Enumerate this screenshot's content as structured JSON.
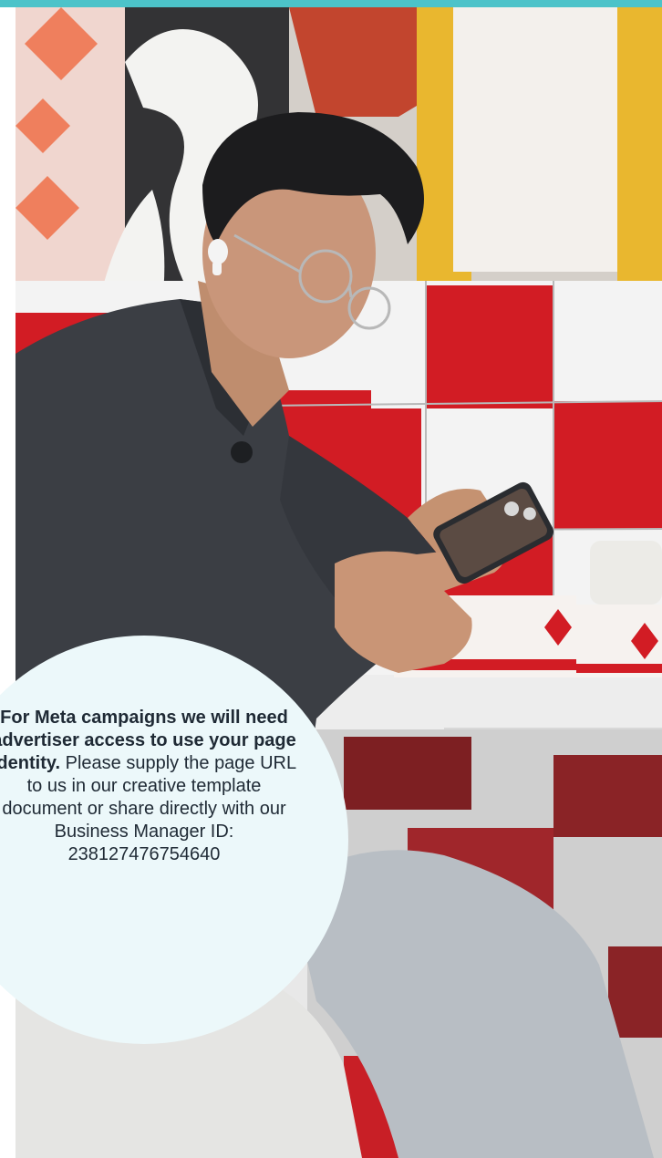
{
  "colors": {
    "accent_bar": "#4cc3c9",
    "bubble_background": "#ecf8fa",
    "text": "#1f2a35"
  },
  "photo": {
    "icon": "person-using-phone-photo"
  },
  "info": {
    "bold_text": "For Meta campaigns we will need advertiser access to use your page identity.",
    "body_text": "Please supply the page URL to us in our creative template document or share directly with our Business Manager ID: 238127476754640"
  }
}
